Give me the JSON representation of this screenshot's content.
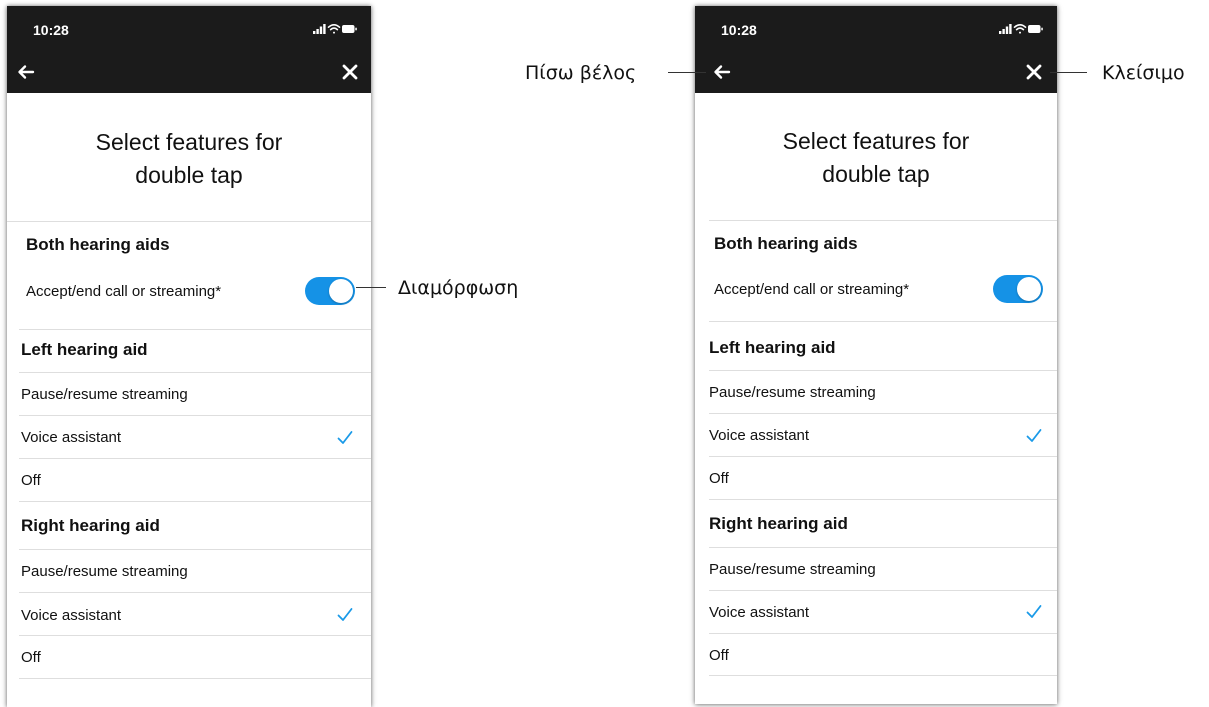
{
  "status_time": "10:28",
  "title_line1": "Select features for",
  "title_line2": "double tap",
  "both_aids": {
    "heading": "Both hearing aids",
    "accept_label": "Accept/end call or streaming*",
    "toggle_on": true
  },
  "left_aid": {
    "heading": "Left hearing aid",
    "options": [
      "Pause/resume streaming",
      "Voice assistant",
      "Off"
    ],
    "selected": "Voice assistant"
  },
  "right_aid": {
    "heading": "Right hearing aid",
    "options": [
      "Pause/resume streaming",
      "Voice assistant",
      "Off"
    ],
    "selected": "Voice assistant"
  },
  "callouts": {
    "back": "Πίσω βέλος",
    "close": "Κλείσιμο",
    "toggle": "Διαμόρφωση"
  },
  "colors": {
    "topbar": "#1b1b1b",
    "accent": "#1592e6",
    "checkmark": "#1a9ae8"
  },
  "icons": {
    "back": "arrow-left-icon",
    "close": "close-icon",
    "check": "checkmark-icon",
    "signal": "signal-icon",
    "wifi": "wifi-icon",
    "battery": "battery-icon"
  }
}
